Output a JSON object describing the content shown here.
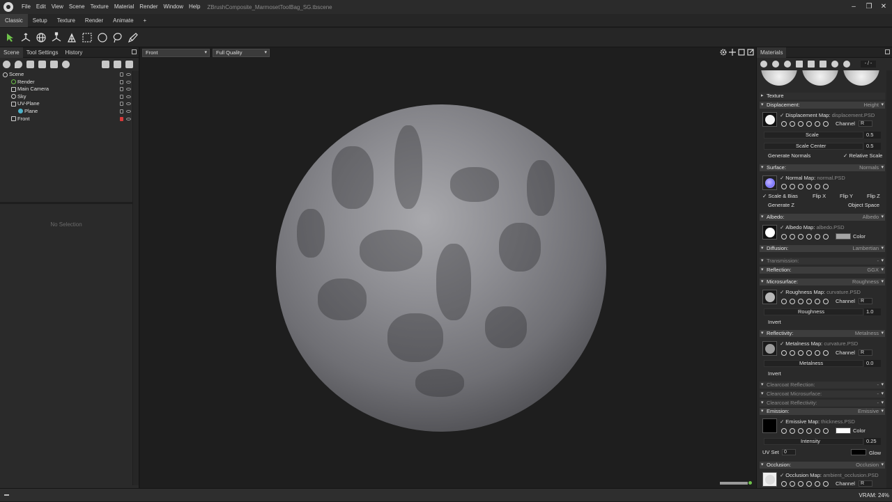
{
  "app": {
    "menu": [
      "File",
      "Edit",
      "View",
      "Scene",
      "Texture",
      "Material",
      "Render",
      "Window",
      "Help"
    ],
    "document_title": "ZBrushComposite_MarmosetToolBag_SG.tbscene"
  },
  "workspace_tabs": [
    "Classic",
    "Setup",
    "Texture",
    "Render",
    "Animate",
    "+"
  ],
  "toolbar_icons": [
    "select-arrow-icon",
    "transform-axis-icon",
    "rotate-globe-icon",
    "scale-axis-icon",
    "lighting-icon",
    "box-select-icon",
    "circle-select-icon",
    "lasso-select-icon",
    "paint-select-icon"
  ],
  "scene_panel": {
    "tabs": [
      "Scene",
      "Tool Settings",
      "History"
    ],
    "tree": [
      {
        "label": "Scene",
        "indent": 0,
        "locked": false
      },
      {
        "label": "Render",
        "indent": 1,
        "locked": false
      },
      {
        "label": "Main Camera",
        "indent": 1,
        "locked": false
      },
      {
        "label": "Sky",
        "indent": 1,
        "locked": false
      },
      {
        "label": "UV-Plane",
        "indent": 1,
        "locked": false
      },
      {
        "label": "Plane",
        "indent": 2,
        "locked": false
      },
      {
        "label": "Front",
        "indent": 1,
        "locked": true
      }
    ],
    "no_selection": "No Selection"
  },
  "viewport": {
    "camera": "Front",
    "quality": "Full Quality"
  },
  "materials": {
    "title": "Materials",
    "counter": "- / -",
    "texture_label": "Texture",
    "displacement": {
      "label": "Displacement:",
      "mode": "Height",
      "map_label": "Displacement Map:",
      "file": "displacement.PSD",
      "channel_label": "Channel",
      "channel": "R",
      "scale_label": "Scale",
      "scale": "0.5",
      "scale_center_label": "Scale Center",
      "scale_center": "0.5",
      "generate_normals": "Generate Normals",
      "relative_scale": "Relative Scale"
    },
    "surface": {
      "label": "Surface:",
      "mode": "Normals",
      "map_label": "Normal Map:",
      "file": "normal.PSD",
      "scale_bias": "Scale & Bias",
      "flip_x": "Flip X",
      "flip_y": "Flip Y",
      "flip_z": "Flip Z",
      "generate_z": "Generate Z",
      "object_space": "Object Space"
    },
    "albedo": {
      "label": "Albedo:",
      "mode": "Albedo",
      "map_label": "Albedo Map:",
      "file": "albedo.PSD",
      "color_label": "Color"
    },
    "diffusion": {
      "label": "Diffusion:",
      "mode": "Lambertian"
    },
    "transmission": {
      "label": "Transmission:"
    },
    "reflection": {
      "label": "Reflection:",
      "mode": "GGX"
    },
    "microsurface": {
      "label": "Microsurface:",
      "mode": "Roughness",
      "map_label": "Roughness Map:",
      "file": "curvature.PSD",
      "channel_label": "Channel",
      "channel": "R",
      "value_label": "Roughness",
      "value": "1.0",
      "invert": "Invert"
    },
    "reflectivity": {
      "label": "Reflectivity:",
      "mode": "Metalness",
      "map_label": "Metalness Map:",
      "file": "curvature.PSD",
      "channel_label": "Channel",
      "channel": "R",
      "value_label": "Metalness",
      "value": "0.0",
      "invert": "Invert"
    },
    "clearcoat_reflection": {
      "label": "Clearcoat Reflection:"
    },
    "clearcoat_microsurface": {
      "label": "Clearcoat Microsurface:"
    },
    "clearcoat_reflectivity": {
      "label": "Clearcoat Reflectivity:"
    },
    "emission": {
      "label": "Emission:",
      "mode": "Emissive",
      "map_label": "Emissive Map:",
      "file": "thickness.PSD",
      "color_label": "Color",
      "intensity_label": "Intensity",
      "intensity": "0.25",
      "uvset_label": "UV Set",
      "uvset": "0",
      "glow_label": "Glow"
    },
    "occlusion": {
      "label": "Occlusion:",
      "mode": "Occlusion",
      "map_label": "Occlusion Map:",
      "file": "ambient_occlusion.PSD",
      "channel_label": "Channel",
      "channel": "R"
    }
  },
  "status": {
    "vram": "VRAM: 24%"
  },
  "colors": {
    "accent_green": "#6ec24a",
    "lock_red": "#d83a3a",
    "panel_bg": "#2a2a2a",
    "viewport_bg": "#1e1e1e"
  }
}
